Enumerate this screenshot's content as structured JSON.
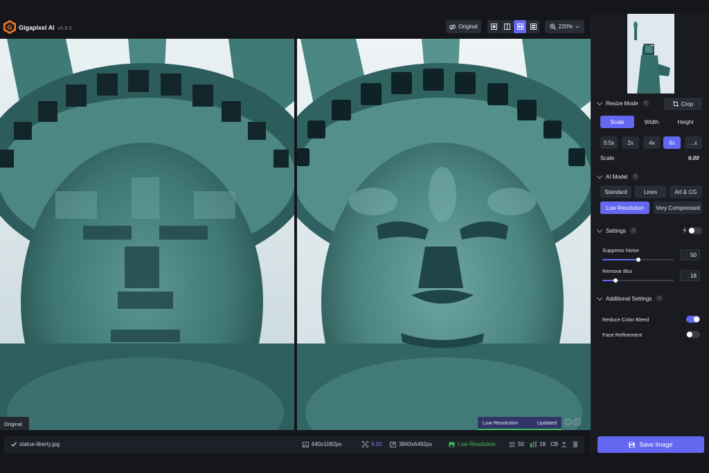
{
  "app": {
    "title": "Gigapixel AI",
    "version": "v5.9.0"
  },
  "toolbar": {
    "original_label": "Original",
    "zoom": "220%"
  },
  "view_modes": [
    "single-view",
    "split-view",
    "side-by-side-view",
    "grid-view"
  ],
  "preview": {
    "left_tag": "Original",
    "model_tag": "Low Resolution",
    "status_tag": "Updated"
  },
  "status_bar": {
    "filename": "statue-liberty.jpg",
    "input_size": "640x1082px",
    "scale": "6.00",
    "output_size": "3840x6492px",
    "model": "Low Resolution",
    "noise": "50",
    "blur": "18",
    "color_bleed": "CB"
  },
  "panel": {
    "resize_mode": {
      "label": "Resize Mode",
      "crop_label": "Crop",
      "modes": [
        "Scale",
        "Width",
        "Height"
      ],
      "active_mode": "Scale",
      "presets": [
        "0.5x",
        "2x",
        "4x",
        "6x",
        "...x"
      ],
      "active_preset": "6x",
      "scale_label": "Scale",
      "scale_value": "6.00"
    },
    "ai_model": {
      "label": "AI Model",
      "models_row1": [
        "Standard",
        "Lines",
        "Art & CG"
      ],
      "models_row2": [
        "Low Resolution",
        "Very Compressed"
      ],
      "active_model": "Low Resolution"
    },
    "settings": {
      "label": "Settings",
      "suppress_noise_label": "Suppress Noise",
      "suppress_noise_value": "50",
      "suppress_noise_fraction": 0.5,
      "remove_blur_label": "Remove Blur",
      "remove_blur_value": "18",
      "remove_blur_fraction": 0.18
    },
    "additional": {
      "label": "Additional Settings",
      "reduce_color_bleed_label": "Reduce Color Bleed",
      "reduce_color_bleed_on": true,
      "face_refinement_label": "Face Refinement",
      "face_refinement_on": false
    },
    "save_label": "Save Image",
    "qmark": "?"
  },
  "colors": {
    "accent": "#6468f0",
    "success": "#3fc45a",
    "background": "#15161b",
    "panel": "#1a1b21"
  }
}
